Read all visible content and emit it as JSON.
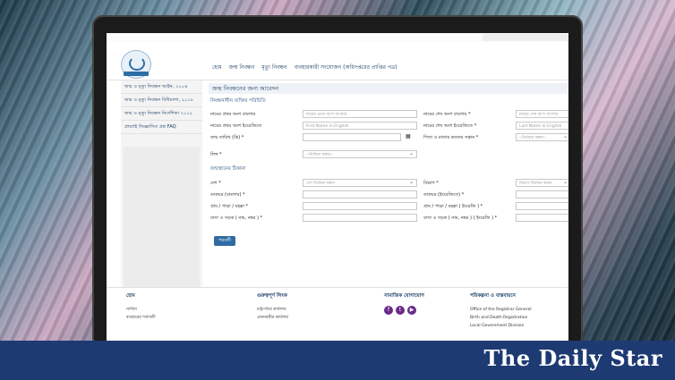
{
  "nav": {
    "items": [
      "হোম",
      "জন্ম নিবন্ধন",
      "মৃত্যু নিবন্ধন",
      "ব্যবহারকারী সংযোজন (অধিদপ্তরের প্রাপ্তির পত্র)"
    ]
  },
  "sidebar": {
    "items": [
      "জন্ম ও মৃত্যু নিবন্ধন আইন, ২০০৪",
      "জন্ম ও মৃত্যু নিবন্ধন বিধিমালা, ২০১৮",
      "জন্ম ও মৃত্যু নিবন্ধন নির্দেশিকা ২০১২",
      "প্রায়শই জিজ্ঞাসিত প্রশ্ন FAQ"
    ]
  },
  "form": {
    "title": "জন্ম নিবন্ধনের জন্য আবেদন",
    "section_personal": "নিবন্ধনাধীন ব্যক্তির পরিচিতি",
    "first_name_bn_label": "নামের প্রথম অংশ বাংলায়",
    "first_name_bn_placeholder": "নামের প্রথম অংশ বাংলায়",
    "last_name_bn_label": "নামের শেষ অংশ বাংলায় *",
    "last_name_bn_placeholder": "নামের শেষ অংশ বাংলায়",
    "first_name_en_label": "নামের প্রথম অংশ ইংরেজিতে",
    "first_name_en_placeholder": "First Name in English",
    "last_name_en_label": "নামের শেষ অংশ ইংরেজিতে *",
    "last_name_en_placeholder": "Last Name in English",
    "dob_label": "জন্ম তারিখ (খ্রি) *",
    "order_label": "পিতা ও মাতার কততম সন্তান *",
    "order_value": "--নির্বাচন করুন--",
    "gender_label": "লিঙ্গ *",
    "gender_value": "--নির্বাচন করুন--",
    "section_birthplace": "জন্মস্থানের ঠিকানা",
    "country_label": "দেশ *",
    "country_value": "দেশ নির্বাচন করুন",
    "division_label": "বিভাগ *",
    "division_value": "বিভাগ নির্বাচন করুন",
    "postoffice_bn_label": "ডাকঘর (বাংলায়) *",
    "postoffice_en_label": "ডাকঘর (ইংরেজিতে) *",
    "village_bn_label": "গ্রাম / পাড়া / মহল্লা *",
    "village_en_label": "গ্রাম / পাড়া / মহল্লা ( ইংরেজি ) *",
    "house_bn_label": "বাসা ও সড়ক ( নাম, নম্বর ) *",
    "house_en_label": "বাসা ও সড়ক ( নাম, নম্বর ) ( ইংরেজি ) *",
    "submit_label": "পরবর্তী"
  },
  "footer": {
    "col1_title": "হোম",
    "col1_items": [
      "সার্ভিস",
      "ব্যবহারের শর্তাবলী"
    ],
    "col2_title": "গুরুত্বপূর্ণ লিংক",
    "col2_items": [
      "রাষ্ট্রপতির কার্যালয়",
      "প্রধানমন্ত্রীর কার্যালয়"
    ],
    "col3_title": "সামাজিক যোগাযোগ",
    "col4_title": "পরিকল্পনা ও বাস্তবায়নে",
    "col4_items": [
      "Office of the Registrar General",
      "Birth and Death Registration",
      "Local Government Division"
    ]
  },
  "watermark": "The Daily Star",
  "colors": {
    "brand": "#1d3a72",
    "social": "#6a2b8a",
    "button": "#2f6aa3"
  }
}
